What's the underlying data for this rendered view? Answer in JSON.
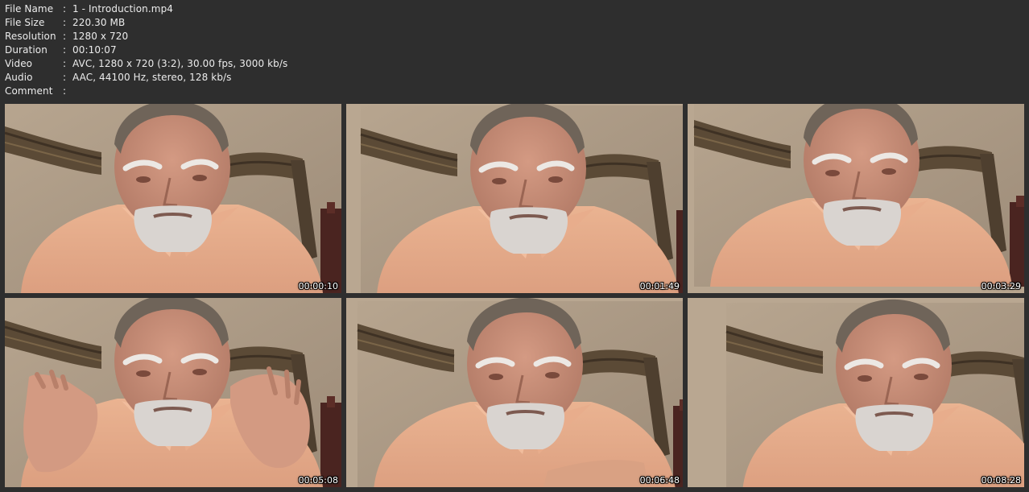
{
  "info": {
    "rows": [
      {
        "label": "File Name",
        "value": "1 - Introduction.mp4"
      },
      {
        "label": "File Size",
        "value": "220.30 MB"
      },
      {
        "label": "Resolution",
        "value": "1280 x 720"
      },
      {
        "label": "Duration",
        "value": "00:10:07"
      },
      {
        "label": "Video",
        "value": "AVC, 1280 x 720 (3:2), 30.00 fps, 3000 kb/s"
      },
      {
        "label": "Audio",
        "value": "AAC, 44100 Hz, stereo, 128 kb/s"
      },
      {
        "label": "Comment",
        "value": ""
      }
    ],
    "separator": ":"
  },
  "thumbnails": [
    {
      "timestamp": "00:00:10"
    },
    {
      "timestamp": "00:01:49"
    },
    {
      "timestamp": "00:03:29"
    },
    {
      "timestamp": "00:05:08"
    },
    {
      "timestamp": "00:06:48"
    },
    {
      "timestamp": "00:08:28"
    }
  ],
  "colors": {
    "background": "#2e2e2e",
    "text": "#ececec",
    "wall": "#b9a791",
    "shirt": "#e8ad8c",
    "skin": "#c98f7a",
    "beard": "#d9d4d0",
    "curtain": "#5b4a36"
  }
}
